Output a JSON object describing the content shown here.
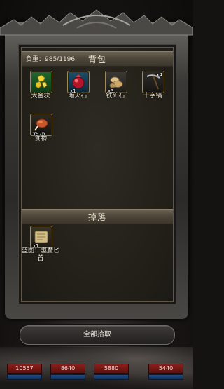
{
  "bag": {
    "weight_label": "负重：985/1196",
    "title": "背包",
    "items": [
      {
        "name": "大金块",
        "qty": "",
        "icon": "gold-nugget-icon",
        "color": "#e0c020"
      },
      {
        "name": "暗火石",
        "qty": "x1",
        "icon": "dark-fire-stone-icon",
        "color": "#c0182a"
      },
      {
        "name": "铁矿石",
        "qty": "x3",
        "icon": "iron-ore-icon",
        "color": "#c9a46a"
      },
      {
        "name": "十字镐",
        "qty": "x4",
        "icon": "pickaxe-icon",
        "color": "#888888"
      },
      {
        "name": "食物",
        "qty": "x976",
        "icon": "roast-meat-icon",
        "color": "#c8552a"
      }
    ]
  },
  "drop": {
    "title": "掉落",
    "items": [
      {
        "name": "蓝图：驱魔匕首",
        "qty": "x1",
        "icon": "blueprint-scroll-icon",
        "color": "#c7b27c"
      }
    ]
  },
  "collect_all_label": "全部拾取",
  "party_hp": [
    "10557",
    "8640",
    "5880",
    "5440"
  ]
}
